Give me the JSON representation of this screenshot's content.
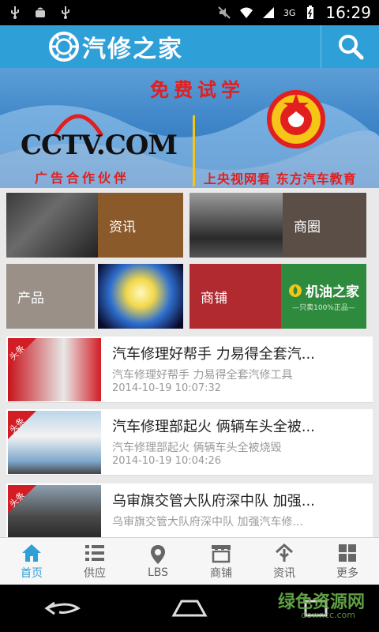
{
  "status_bar": {
    "time": "16:29",
    "network": "3G",
    "icons_left": [
      "usb-icon",
      "android-debug-icon",
      "usb-icon"
    ],
    "icons_right": [
      "mute-icon",
      "wifi-icon",
      "signal-icon",
      "battery-icon"
    ]
  },
  "app_bar": {
    "title": "汽修之家",
    "search_icon": "search-icon",
    "color": "#2f9fd8"
  },
  "banner": {
    "headline": "免费试学",
    "logo_text": "CCTV.COM",
    "partner_text": "广告合作伙伴",
    "school_text": "上央视网看 东方汽车教育",
    "emblem": "school-emblem"
  },
  "categories": [
    {
      "label": "资讯",
      "color": "#8b5a2b"
    },
    {
      "label": "商圈",
      "color": "#5a4e46"
    },
    {
      "label": "产品",
      "color": "#9a9087"
    },
    {
      "label": "商铺",
      "color": "#b02a30"
    }
  ],
  "promo_tile": {
    "brand": "机油之家",
    "tagline": "—只卖100%正品—"
  },
  "news": [
    {
      "badge": "头条",
      "title": "汽车修理好帮手 力易得全套汽...",
      "summary": "汽车修理好帮手 力易得全套汽修工具",
      "time": "2014-10-19 10:07:32"
    },
    {
      "badge": "头条",
      "title": "汽车修理部起火 俩辆车头全被...",
      "summary": "汽车修理部起火 俩辆车头全被烧毁",
      "time": "2014-10-19 10:04:26"
    },
    {
      "badge": "头条",
      "title": "乌审旗交管大队府深中队 加强...",
      "summary": "乌审旗交管大队府深中队 加强汽车修...",
      "time": ""
    }
  ],
  "bottom_nav": [
    {
      "label": "首页",
      "icon": "home-icon",
      "active": true
    },
    {
      "label": "供应",
      "icon": "list-icon",
      "active": false
    },
    {
      "label": "LBS",
      "icon": "location-pin-icon",
      "active": false
    },
    {
      "label": "商铺",
      "icon": "store-icon",
      "active": false
    },
    {
      "label": "资讯",
      "icon": "news-icon",
      "active": false
    },
    {
      "label": "更多",
      "icon": "grid-icon",
      "active": false
    }
  ],
  "system_nav": [
    "back-icon",
    "home-button-icon",
    "recents-icon"
  ],
  "watermark": {
    "brand": "绿色资源网",
    "domain": "downcc.com"
  },
  "colors": {
    "accent": "#2f9fd8",
    "nav_active": "#2f9fd8",
    "nav_inactive": "#666666"
  }
}
